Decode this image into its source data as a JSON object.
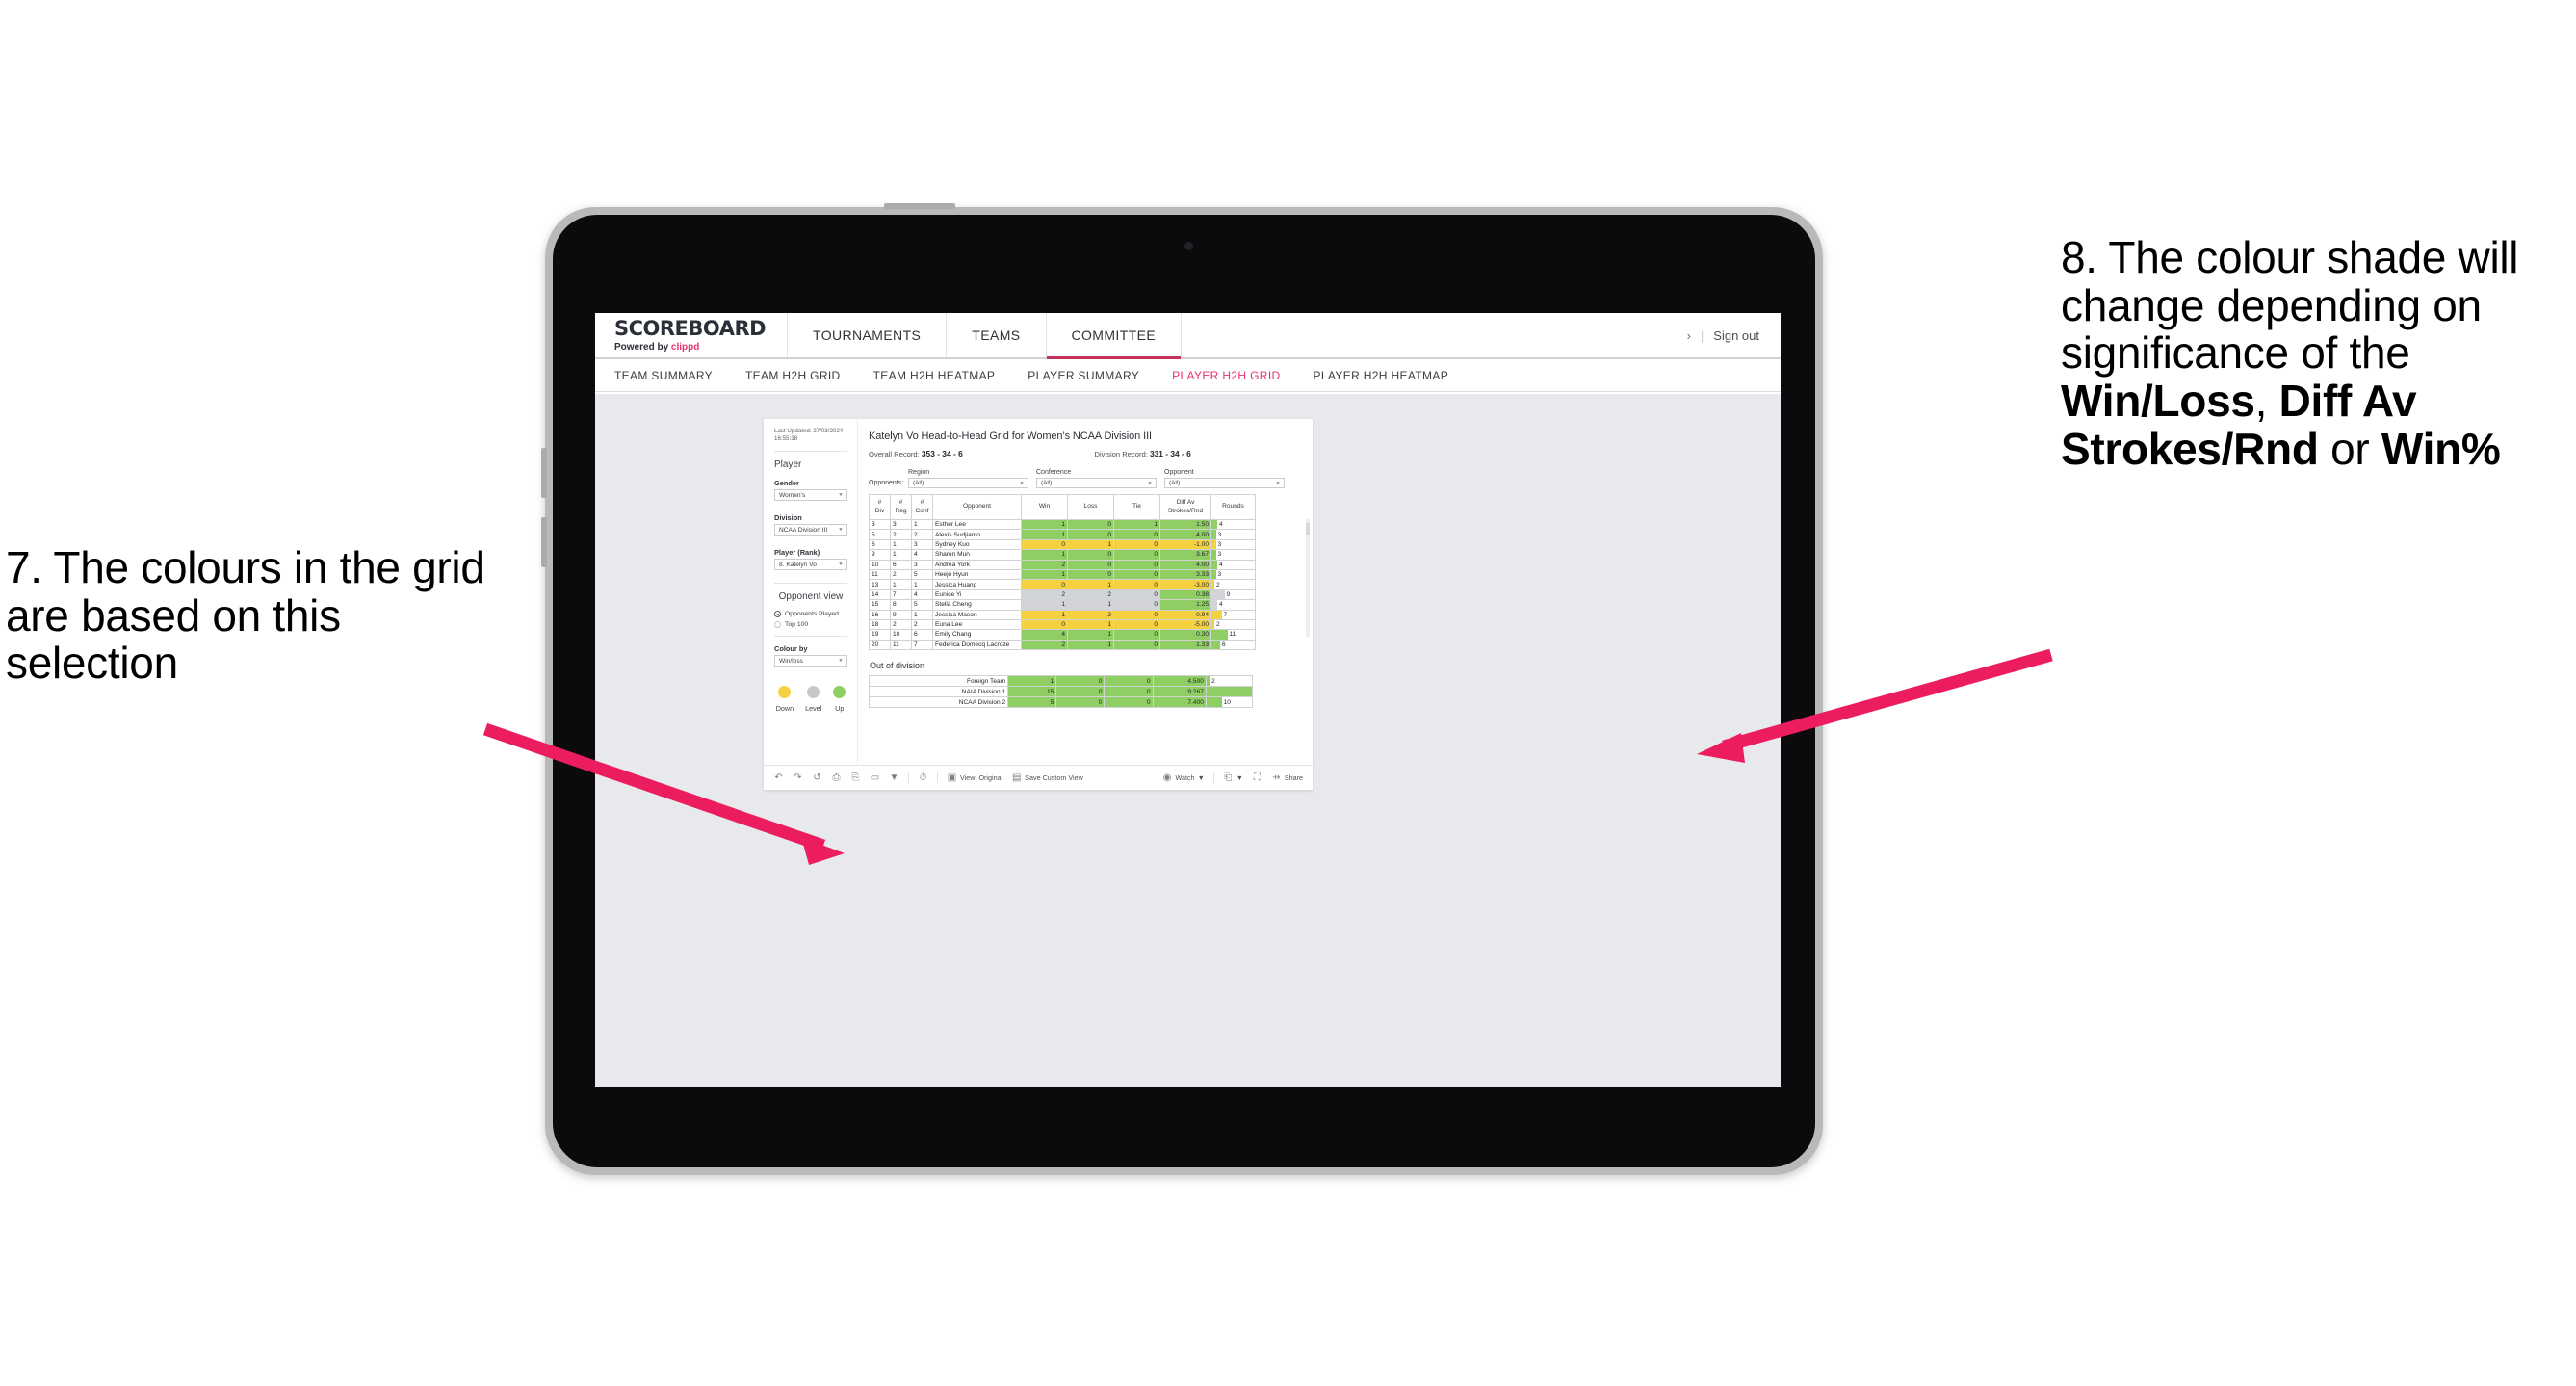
{
  "annotations": {
    "left": {
      "id": "annotation-7",
      "text": "7. The colours in the grid are based on this selection"
    },
    "right": {
      "id": "annotation-8",
      "prefix": "8. The colour shade will change depending on significance of the ",
      "bold1": "Win/Loss",
      "mid1": ", ",
      "bold2": "Diff Av Strokes/Rnd",
      "mid2": " or ",
      "bold3": "Win%"
    },
    "arrow_color": "#ec1d5e"
  },
  "header": {
    "brand_title": "SCOREBOARD",
    "brand_sub_prefix": "Powered by ",
    "brand_sub_brand": "clippd",
    "nav": [
      {
        "label": "TOURNAMENTS",
        "active": false
      },
      {
        "label": "TEAMS",
        "active": false
      },
      {
        "label": "COMMITTEE",
        "active": true
      }
    ],
    "chevron": "›",
    "separator": "|",
    "sign_out": "Sign out"
  },
  "subnav": [
    {
      "label": "TEAM SUMMARY",
      "active": false
    },
    {
      "label": "TEAM H2H GRID",
      "active": false
    },
    {
      "label": "TEAM H2H HEATMAP",
      "active": false
    },
    {
      "label": "PLAYER SUMMARY",
      "active": false
    },
    {
      "label": "PLAYER H2H GRID",
      "active": true
    },
    {
      "label": "PLAYER H2H HEATMAP",
      "active": false
    }
  ],
  "sidebar": {
    "last_updated_line1": "Last Updated: 27/03/2024",
    "last_updated_line2": "16:55:38",
    "player_heading": "Player",
    "gender_label": "Gender",
    "gender_value": "Women’s",
    "division_label": "Division",
    "division_value": "NCAA Division III",
    "player_rank_label": "Player (Rank)",
    "player_rank_value": "8. Katelyn Vo",
    "opponent_view_heading": "Opponent view",
    "opponent_view_options": [
      {
        "label": "Opponents Played",
        "selected": true
      },
      {
        "label": "Top 100",
        "selected": false
      }
    ],
    "colour_by_label": "Colour by",
    "colour_by_value": "Win/loss",
    "legend": [
      {
        "label": "Down",
        "color": "#f5d13f"
      },
      {
        "label": "Level",
        "color": "#c5c8cb"
      },
      {
        "label": "Up",
        "color": "#8fce62"
      }
    ]
  },
  "main": {
    "title": "Katelyn Vo Head-to-Head Grid for Women’s NCAA Division III",
    "overall_record_label": "Overall Record:",
    "overall_record_value": "353 -  34 - 6",
    "division_record_label": "Division Record:",
    "division_record_value": "331 -  34 - 6",
    "opponents_label": "Opponents:",
    "filters": [
      {
        "label": "Region",
        "value": "(All)"
      },
      {
        "label": "Conference",
        "value": "(All)"
      },
      {
        "label": "Opponent",
        "value": "(All)"
      }
    ],
    "out_of_division_title": "Out of division"
  },
  "chart_data": {
    "type": "table",
    "title": "Katelyn Vo Head-to-Head Grid for Women’s NCAA Division III",
    "columns": [
      "# Div",
      "# Reg",
      "# Conf",
      "Opponent",
      "Win",
      "Loss",
      "Tie",
      "Diff Av Strokes/Rnd",
      "Rounds"
    ],
    "column_headers_multiline": [
      {
        "l1": "#",
        "l2": "Div"
      },
      {
        "l1": "#",
        "l2": "Reg"
      },
      {
        "l1": "#",
        "l2": "Conf"
      },
      {
        "l1": "Opponent",
        "l2": ""
      },
      {
        "l1": "Win",
        "l2": ""
      },
      {
        "l1": "Loss",
        "l2": ""
      },
      {
        "l1": "Tie",
        "l2": ""
      },
      {
        "l1": "Diff Av",
        "l2": "Strokes/Rnd"
      },
      {
        "l1": "Rounds",
        "l2": ""
      }
    ],
    "colour_mode": "Win/loss",
    "colors": {
      "up": "#8fce62",
      "down": "#f5d13f",
      "level": "#d2d4d7"
    },
    "rounds_max": 30,
    "rows": [
      {
        "div": "3",
        "reg": "3",
        "conf": "1",
        "opponent": "Esther Lee",
        "win": "1",
        "loss": "0",
        "tie": "1",
        "diff": "1.50",
        "rounds": "4",
        "state": "up"
      },
      {
        "div": "5",
        "reg": "2",
        "conf": "2",
        "opponent": "Alexis Sudjianto",
        "win": "1",
        "loss": "0",
        "tie": "0",
        "diff": "4.00",
        "rounds": "3",
        "state": "up"
      },
      {
        "div": "6",
        "reg": "1",
        "conf": "3",
        "opponent": "Sydney Kuo",
        "win": "0",
        "loss": "1",
        "tie": "0",
        "diff": "-1.00",
        "rounds": "3",
        "state": "down"
      },
      {
        "div": "9",
        "reg": "1",
        "conf": "4",
        "opponent": "Sharon Mun",
        "win": "1",
        "loss": "0",
        "tie": "0",
        "diff": "3.67",
        "rounds": "3",
        "state": "up"
      },
      {
        "div": "10",
        "reg": "6",
        "conf": "3",
        "opponent": "Andrea York",
        "win": "2",
        "loss": "0",
        "tie": "0",
        "diff": "4.00",
        "rounds": "4",
        "state": "up"
      },
      {
        "div": "11",
        "reg": "2",
        "conf": "5",
        "opponent": "Heejo Hyun",
        "win": "1",
        "loss": "0",
        "tie": "0",
        "diff": "3.33",
        "rounds": "3",
        "state": "up"
      },
      {
        "div": "13",
        "reg": "1",
        "conf": "1",
        "opponent": "Jessica Huang",
        "win": "0",
        "loss": "1",
        "tie": "0",
        "diff": "-3.00",
        "rounds": "2",
        "state": "down"
      },
      {
        "div": "14",
        "reg": "7",
        "conf": "4",
        "opponent": "Eunice Yi",
        "win": "2",
        "loss": "2",
        "tie": "0",
        "diff": "0.38",
        "rounds": "9",
        "state": "level",
        "diff_state": "up"
      },
      {
        "div": "15",
        "reg": "8",
        "conf": "5",
        "opponent": "Stella Cheng",
        "win": "1",
        "loss": "1",
        "tie": "0",
        "diff": "1.25",
        "rounds": "4",
        "state": "level",
        "diff_state": "up"
      },
      {
        "div": "16",
        "reg": "9",
        "conf": "1",
        "opponent": "Jessica Mason",
        "win": "1",
        "loss": "2",
        "tie": "0",
        "diff": "-0.94",
        "rounds": "7",
        "state": "down"
      },
      {
        "div": "18",
        "reg": "2",
        "conf": "2",
        "opponent": "Euna Lee",
        "win": "0",
        "loss": "1",
        "tie": "0",
        "diff": "-5.00",
        "rounds": "2",
        "state": "down"
      },
      {
        "div": "19",
        "reg": "10",
        "conf": "6",
        "opponent": "Emily Chang",
        "win": "4",
        "loss": "1",
        "tie": "0",
        "diff": "0.30",
        "rounds": "11",
        "state": "up"
      },
      {
        "div": "20",
        "reg": "11",
        "conf": "7",
        "opponent": "Federica Domecq Lacroze",
        "win": "2",
        "loss": "1",
        "tie": "0",
        "diff": "1.33",
        "rounds": "6",
        "state": "up"
      }
    ],
    "out_of_division": {
      "rounds_max": 30,
      "rows": [
        {
          "name": "Foreign Team",
          "win": "1",
          "loss": "0",
          "tie": "0",
          "diff": "4.500",
          "rounds": "2",
          "state": "up"
        },
        {
          "name": "NAIA Division 1",
          "win": "15",
          "loss": "0",
          "tie": "0",
          "diff": "9.267",
          "rounds": "30",
          "state": "up"
        },
        {
          "name": "NCAA Division 2",
          "win": "5",
          "loss": "0",
          "tie": "0",
          "diff": "7.400",
          "rounds": "10",
          "state": "up"
        }
      ]
    }
  },
  "toolbar": {
    "view_label": "View: Original",
    "save_label": "Save Custom View",
    "watch_label": "Watch",
    "share_label": "Share"
  }
}
